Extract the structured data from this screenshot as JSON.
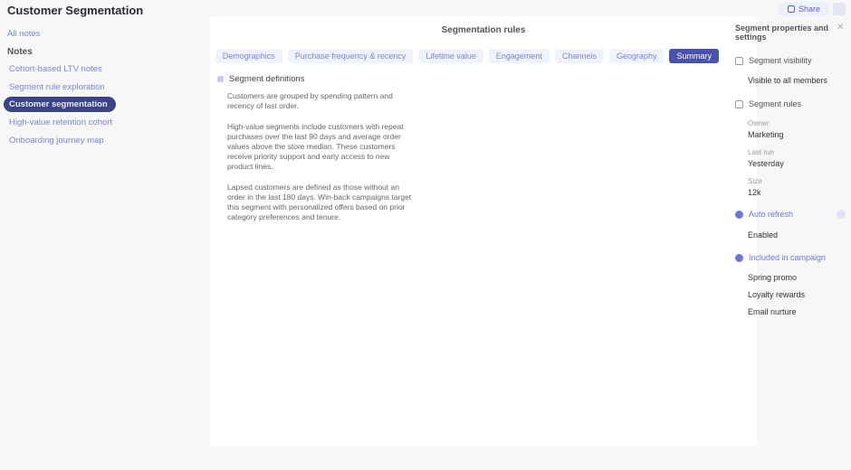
{
  "app": {
    "title": "Customer Segmentation"
  },
  "top": {
    "button_label": "Share"
  },
  "sidebar": {
    "back_link": "All notes",
    "heading": "Notes",
    "items": [
      {
        "label": "Cohort-based LTV notes",
        "active": false
      },
      {
        "label": "Segment rule exploration",
        "active": false
      },
      {
        "label": "Customer segmentation",
        "active": true
      },
      {
        "label": "High-value retention cohort",
        "active": false
      },
      {
        "label": "Onboarding journey map",
        "active": false
      }
    ]
  },
  "center": {
    "title": "Segmentation rules",
    "tabs": [
      {
        "label": "Demographics",
        "active": false
      },
      {
        "label": "Purchase frequency & recency",
        "active": false
      },
      {
        "label": "Lifetime value",
        "active": false
      },
      {
        "label": "Engagement",
        "active": false
      },
      {
        "label": "Channels",
        "active": false
      },
      {
        "label": "Geography",
        "active": false
      },
      {
        "label": "Summary",
        "active": true
      }
    ],
    "content": {
      "heading": "Segment definitions",
      "paragraphs": [
        "Customers are grouped by spending pattern and recency of last order.",
        "High-value segments include customers with repeat purchases over the last 90 days and average order values above the store median. These customers receive priority support and early access to new product lines.",
        "Lapsed customers are defined as those without an order in the last 180 days. Win-back campaigns target this segment with personalized offers based on prior category preferences and tenure."
      ]
    }
  },
  "right": {
    "title": "Segment properties and settings",
    "close_icon": "close-icon",
    "sections": [
      {
        "label": "Segment visibility",
        "type": "checkbox",
        "value": "Visible to all members"
      },
      {
        "label": "Segment rules",
        "type": "checkbox"
      }
    ],
    "fields": [
      {
        "label": "Owner",
        "value": "Marketing"
      },
      {
        "label": "Last run",
        "value": "Yesterday"
      },
      {
        "label": "Size",
        "value": "12k"
      }
    ],
    "toggles": [
      {
        "label": "Auto refresh",
        "value": "Enabled"
      },
      {
        "label": "Included in campaign",
        "values": [
          "Spring promo",
          "Loyalty rewards",
          "Email nurture"
        ]
      }
    ]
  }
}
